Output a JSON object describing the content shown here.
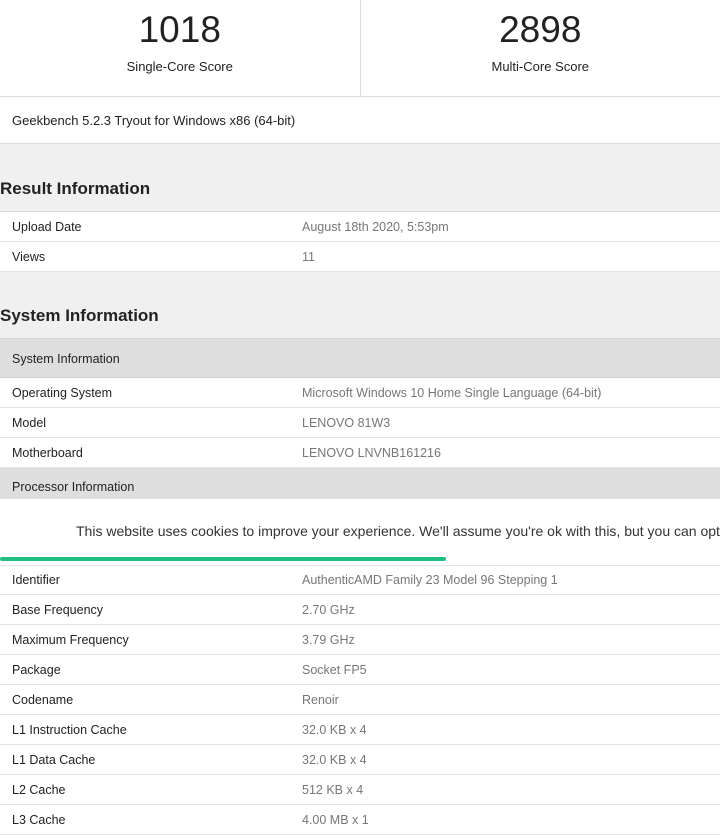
{
  "scores": {
    "single": {
      "value": "1018",
      "label": "Single-Core Score"
    },
    "multi": {
      "value": "2898",
      "label": "Multi-Core Score"
    }
  },
  "version": "Geekbench 5.2.3 Tryout for Windows x86 (64-bit)",
  "result_info": {
    "title": "Result Information",
    "rows": [
      {
        "key": "Upload Date",
        "value": "August 18th 2020, 5:53pm"
      },
      {
        "key": "Views",
        "value": "11"
      }
    ]
  },
  "system_info": {
    "title": "System Information",
    "group_system": "System Information",
    "system_rows": [
      {
        "key": "Operating System",
        "value": "Microsoft Windows 10 Home Single Language (64-bit)"
      },
      {
        "key": "Model",
        "value": "LENOVO 81W3"
      },
      {
        "key": "Motherboard",
        "value": "LENOVO LNVNB161216"
      }
    ],
    "group_processor": "Processor Information",
    "processor_rows": [
      {
        "key": "Identifier",
        "value": "AuthenticAMD Family 23 Model 96 Stepping 1"
      },
      {
        "key": "Base Frequency",
        "value": "2.70 GHz"
      },
      {
        "key": "Maximum Frequency",
        "value": "3.79 GHz"
      },
      {
        "key": "Package",
        "value": "Socket FP5"
      },
      {
        "key": "Codename",
        "value": "Renoir"
      },
      {
        "key": "L1 Instruction Cache",
        "value": "32.0 KB x 4"
      },
      {
        "key": "L1 Data Cache",
        "value": "32.0 KB x 4"
      },
      {
        "key": "L2 Cache",
        "value": "512 KB x 4"
      },
      {
        "key": "L3 Cache",
        "value": "4.00 MB x 1"
      }
    ]
  },
  "cookie_banner": {
    "text": "This website uses cookies to improve your experience. We'll assume you're ok with this, but you can opt-out if you wish.",
    "progress": 0.62,
    "accent": "#1fbf82"
  }
}
